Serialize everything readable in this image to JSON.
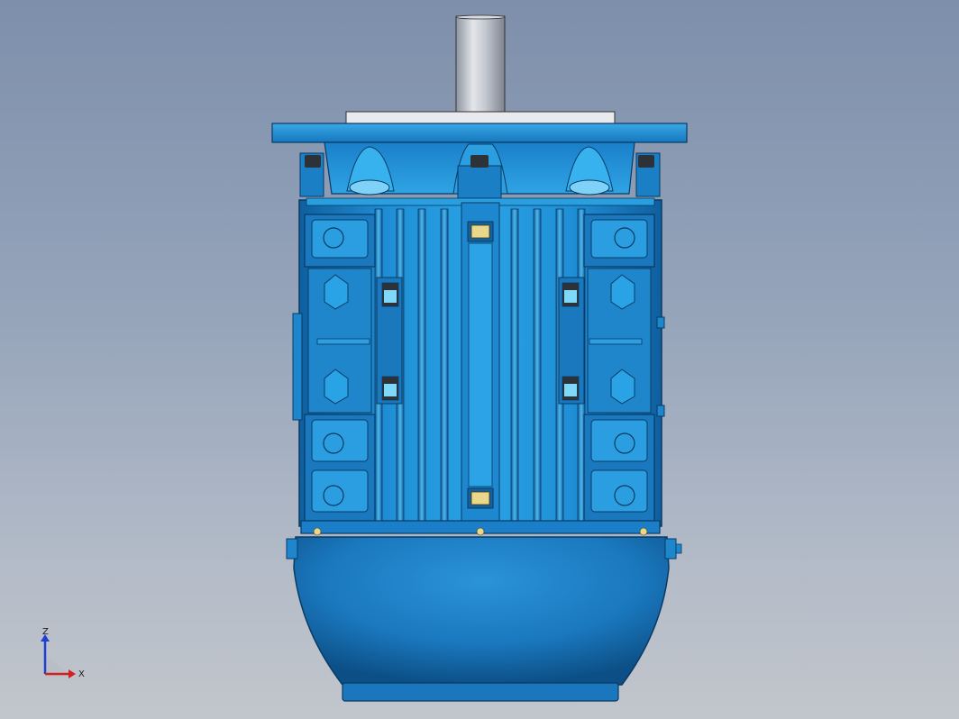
{
  "scene": {
    "model": "electric-motor",
    "background_top": "#7d8fab",
    "background_bottom": "#c2c6cc",
    "body_color": "#1e8fd6",
    "body_dark": "#0d5f9e",
    "body_light": "#5cc2f2",
    "shaft_color": "#c9ced6",
    "flange_color": "#2a97dc"
  },
  "triad": {
    "z_label": "Z",
    "x_label": "X",
    "z_color": "#1f3fd0",
    "x_color": "#d42020"
  }
}
